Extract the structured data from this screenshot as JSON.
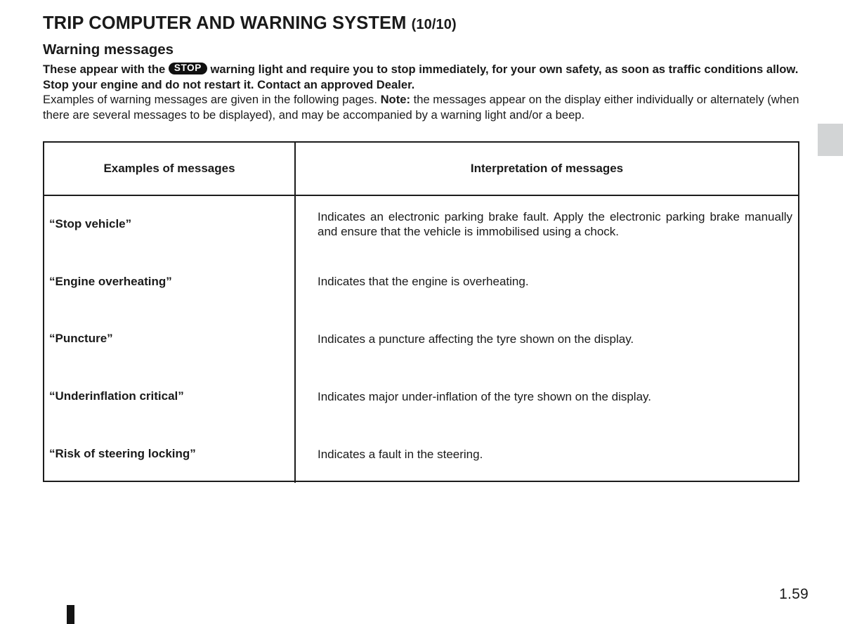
{
  "page": {
    "chapter_title": "TRIP COMPUTER AND WARNING SYSTEM",
    "chapter_pager": "(10/10)",
    "section_title": "Warning messages",
    "page_number": "1.59"
  },
  "intro": {
    "line1_before_badge": "These appear with the",
    "badge_label": "STOP",
    "line1_after_badge": "warning light and require you to stop immediately, for your own safety, as soon as traffic conditions allow. Stop your engine and do not restart it. Contact an approved Dealer.",
    "line2_part1": "Examples of warning messages are given in the following pages.",
    "line2_note_label": "Note:",
    "line2_part2": "the messages appear on the display either individually or alternately (when there are several messages to be displayed), and may be accompanied by a warning light and/or a beep."
  },
  "table": {
    "headers": {
      "examples": "Examples of messages",
      "interpretation": "Interpretation of messages"
    },
    "rows": [
      {
        "message": "“Stop vehicle”",
        "interpretation": "Indicates an electronic parking brake fault. Apply the electronic parking brake manually and ensure that the vehicle is immobilised using a chock."
      },
      {
        "message": "“Engine overheating”",
        "interpretation": "Indicates that the engine is overheating."
      },
      {
        "message": "“Puncture”",
        "interpretation": "Indicates a puncture affecting the tyre shown on the display."
      },
      {
        "message": "“Underinflation critical”",
        "interpretation": "Indicates major under-inflation of the tyre shown on the display."
      },
      {
        "message": "“Risk of steering locking”",
        "interpretation": "Indicates a fault in the steering."
      }
    ]
  },
  "colors": {
    "text": "#1a1a1a",
    "rule": "#1c1c1c",
    "side_tab": "#d2d4d5",
    "marker": "#141414",
    "badge_bg": "#111111"
  }
}
